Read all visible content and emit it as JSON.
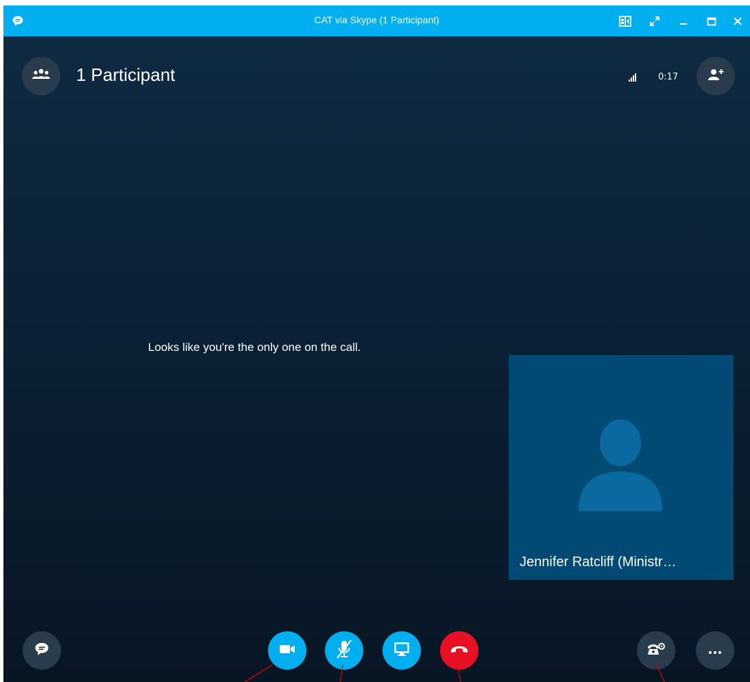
{
  "window": {
    "title": "CAT via Skype (1 Participant)"
  },
  "header": {
    "participants_label": "1 Participant",
    "call_timer": "0:17"
  },
  "main": {
    "alone_message": "Looks like you're the only one on the call."
  },
  "tile": {
    "name": "Jennifer Ratcliff (Ministr…"
  },
  "icons": {
    "titlebar": [
      "chat-icon",
      "compact-view-icon",
      "fullscreen-icon",
      "minimize-icon",
      "maximize-icon",
      "close-icon"
    ],
    "header": [
      "participants-icon",
      "signal-icon",
      "add-participant-icon"
    ],
    "controls": [
      "im-icon",
      "video-camera-icon",
      "mic-muted-icon",
      "screen-share-icon",
      "hang-up-icon",
      "call-controls-icon",
      "more-options-icon"
    ]
  },
  "colors": {
    "titlebar": "#00aff0",
    "background_top": "#0e2b43",
    "background_bottom": "#081624",
    "tile": "#004a73",
    "avatar": "#0a6aa0",
    "control_blue": "#00aff0",
    "hang_up": "#e81123",
    "dark_button": "#2a3b4c",
    "annotation": "#e00000"
  }
}
